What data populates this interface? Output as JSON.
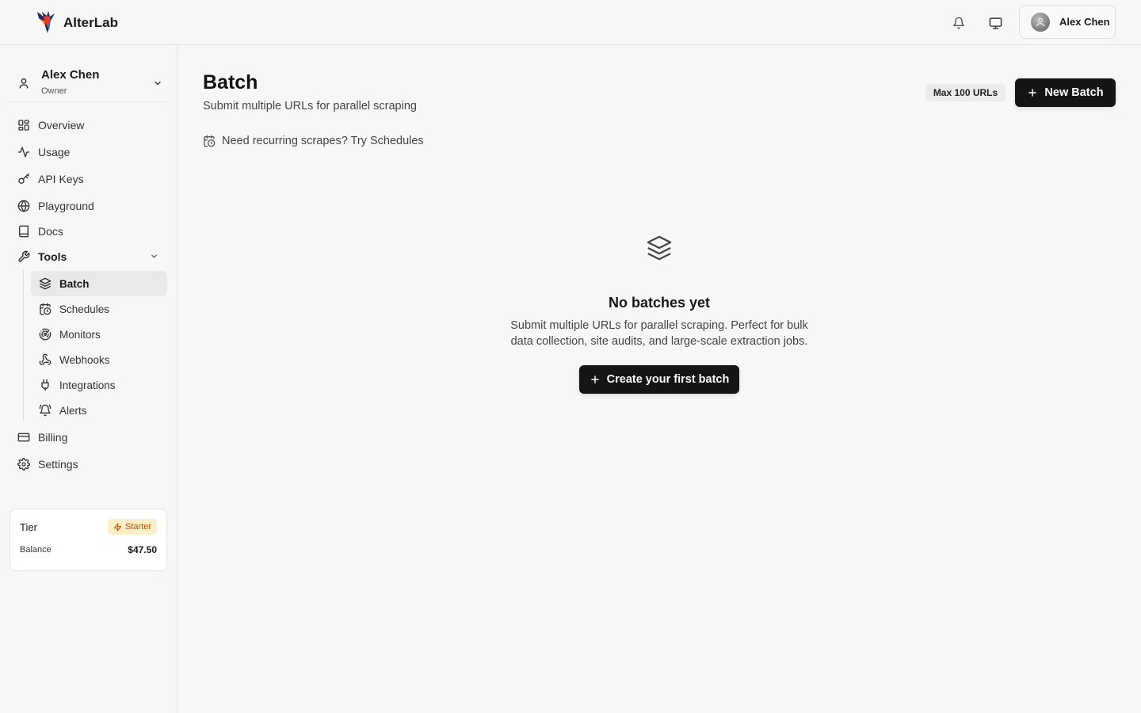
{
  "brand": {
    "name": "AlterLab"
  },
  "topbar": {
    "notifications_icon": "bell-icon",
    "display_icon": "monitor-icon",
    "user_name": "Alex Chen"
  },
  "account": {
    "name": "Alex Chen",
    "role": "Owner"
  },
  "sidebar": {
    "items": [
      {
        "label": "Overview",
        "icon": "layout-grid-icon"
      },
      {
        "label": "Usage",
        "icon": "activity-icon"
      },
      {
        "label": "API Keys",
        "icon": "key-icon"
      },
      {
        "label": "Playground",
        "icon": "globe-icon"
      },
      {
        "label": "Docs",
        "icon": "book-icon"
      },
      {
        "label": "Tools",
        "icon": "wrench-icon"
      },
      {
        "label": "Billing",
        "icon": "credit-card-icon"
      },
      {
        "label": "Settings",
        "icon": "gear-icon"
      }
    ],
    "tools": [
      {
        "label": "Batch",
        "icon": "layers-icon",
        "active": true
      },
      {
        "label": "Schedules",
        "icon": "calendar-clock-icon"
      },
      {
        "label": "Monitors",
        "icon": "radar-icon"
      },
      {
        "label": "Webhooks",
        "icon": "webhook-icon"
      },
      {
        "label": "Integrations",
        "icon": "plug-icon"
      },
      {
        "label": "Alerts",
        "icon": "bell-ring-icon"
      }
    ]
  },
  "tier_card": {
    "tier_label": "Tier",
    "tier_badge": "Starter",
    "balance_label": "Balance",
    "balance_value": "$47.50"
  },
  "main": {
    "title": "Batch",
    "subtitle": "Submit multiple URLs for parallel scraping",
    "max_pill": "Max 100 URLs",
    "new_batch_label": "New Batch",
    "hint_text": "Need recurring scrapes? Try Schedules",
    "empty_title": "No batches yet",
    "empty_description": "Submit multiple URLs for parallel scraping. Perfect for bulk data collection, site audits, and large-scale extraction jobs.",
    "create_first_label": "Create your first batch"
  },
  "colors": {
    "accent": "#151515",
    "badge_bg": "#fcefc7",
    "badge_text": "#b45309"
  }
}
